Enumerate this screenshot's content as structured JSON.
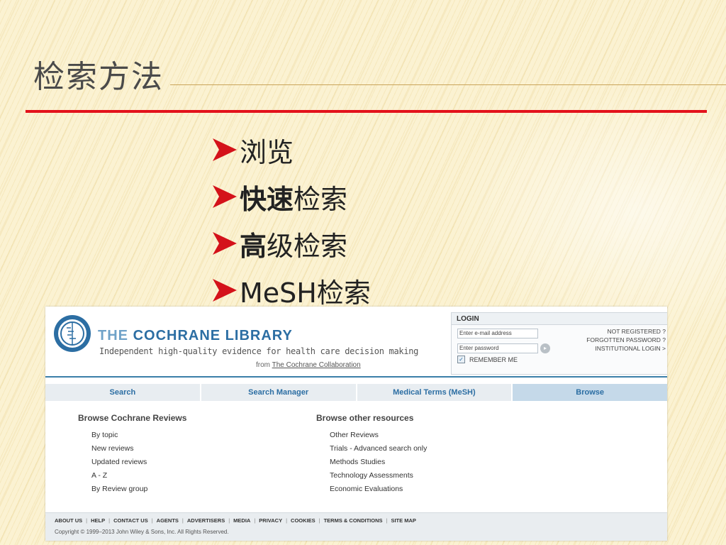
{
  "slide": {
    "title": "检索方法",
    "bullets": [
      {
        "bold": "",
        "rest": "浏览"
      },
      {
        "bold": "快速",
        "rest": "检索"
      },
      {
        "bold": "高",
        "rest": "级检索"
      },
      {
        "bold": "",
        "rest": "MeSH检索"
      }
    ],
    "colors": {
      "rule": "#e3121b",
      "arrow": "#d4121a"
    }
  },
  "cochrane": {
    "brand_light": "THE ",
    "brand_dark": "COCHRANE LIBRARY",
    "tagline": "Independent high-quality evidence for health care decision making",
    "from_prefix": "from ",
    "from_link": "The Cochrane Collaboration",
    "login": {
      "heading": "LOGIN",
      "email_placeholder": "Enter e-mail address",
      "password_placeholder": "Enter password",
      "remember": "REMEMBER ME",
      "links": [
        "NOT REGISTERED ?",
        "FORGOTTEN PASSWORD ?",
        "INSTITUTIONAL LOGIN >"
      ]
    },
    "nav": [
      {
        "label": "Search",
        "active": false
      },
      {
        "label": "Search Manager",
        "active": false
      },
      {
        "label": "Medical Terms (MeSH)",
        "active": false
      },
      {
        "label": "Browse",
        "active": true
      }
    ],
    "browse_reviews": {
      "title": "Browse Cochrane Reviews",
      "items": [
        "By topic",
        "New reviews",
        "Updated reviews",
        "A - Z",
        "By Review group"
      ]
    },
    "browse_other": {
      "title": "Browse other resources",
      "items": [
        "Other Reviews",
        "Trials - Advanced search only",
        "Methods Studies",
        "Technology Assessments",
        "Economic Evaluations"
      ]
    },
    "footer_links": [
      "ABOUT US",
      "HELP",
      "CONTACT US",
      "AGENTS",
      "ADVERTISERS",
      "MEDIA",
      "PRIVACY",
      "COOKIES",
      "TERMS & CONDITIONS",
      "SITE MAP"
    ],
    "copyright": "Copyright © 1999–2013 John Wiley & Sons, Inc. All Rights Reserved."
  }
}
